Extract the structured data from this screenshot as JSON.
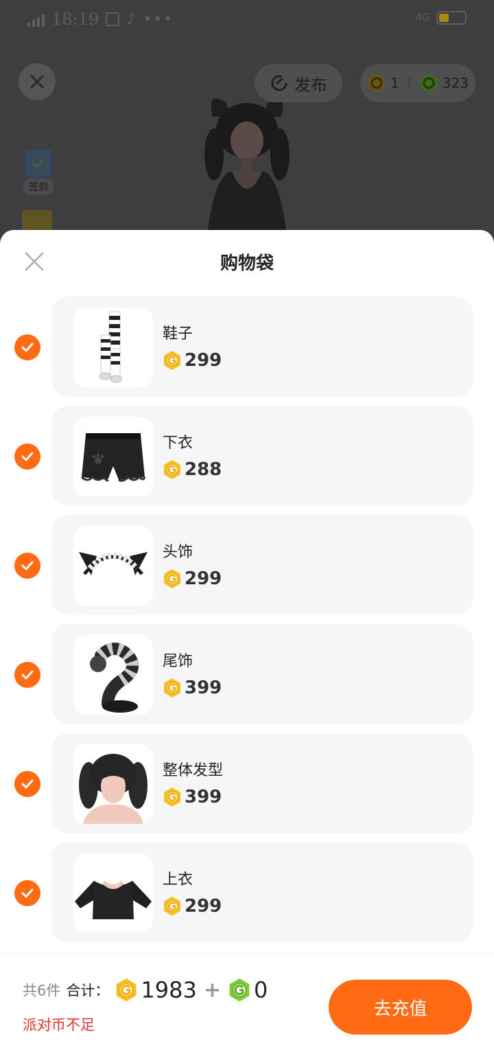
{
  "status_bar": {
    "network": "4G",
    "time": "18:19",
    "battery_level": 0.4
  },
  "toolbar": {
    "publish_label": "发布",
    "gold_coin_count": "1",
    "green_coin_count": "323"
  },
  "sidebar": {
    "checkin_label": "签到"
  },
  "sheet": {
    "title": "购物袋",
    "items": [
      {
        "name": "鞋子",
        "price": "299",
        "checked": true,
        "thumb_icon": "striped-stockings-icon"
      },
      {
        "name": "下衣",
        "price": "288",
        "checked": true,
        "thumb_icon": "bloomer-shorts-icon"
      },
      {
        "name": "头饰",
        "price": "299",
        "checked": true,
        "thumb_icon": "maid-headband-cat-ears-icon"
      },
      {
        "name": "尾饰",
        "price": "399",
        "checked": true,
        "thumb_icon": "striped-tail-icon"
      },
      {
        "name": "整体发型",
        "price": "399",
        "checked": true,
        "thumb_icon": "twin-tail-hair-icon"
      },
      {
        "name": "上衣",
        "price": "299",
        "checked": true,
        "thumb_icon": "black-top-icon"
      }
    ]
  },
  "footer": {
    "count_text": "共6件",
    "total_label": "合计：",
    "gold_total": "1983",
    "plus": "+",
    "green_total": "0",
    "warning": "派对币不足",
    "recharge_label": "去充值"
  },
  "colors": {
    "accent": "#ff6a13",
    "warning": "#e0322a",
    "gold_coin": "#f5c022",
    "green_coin": "#7dc93a"
  }
}
